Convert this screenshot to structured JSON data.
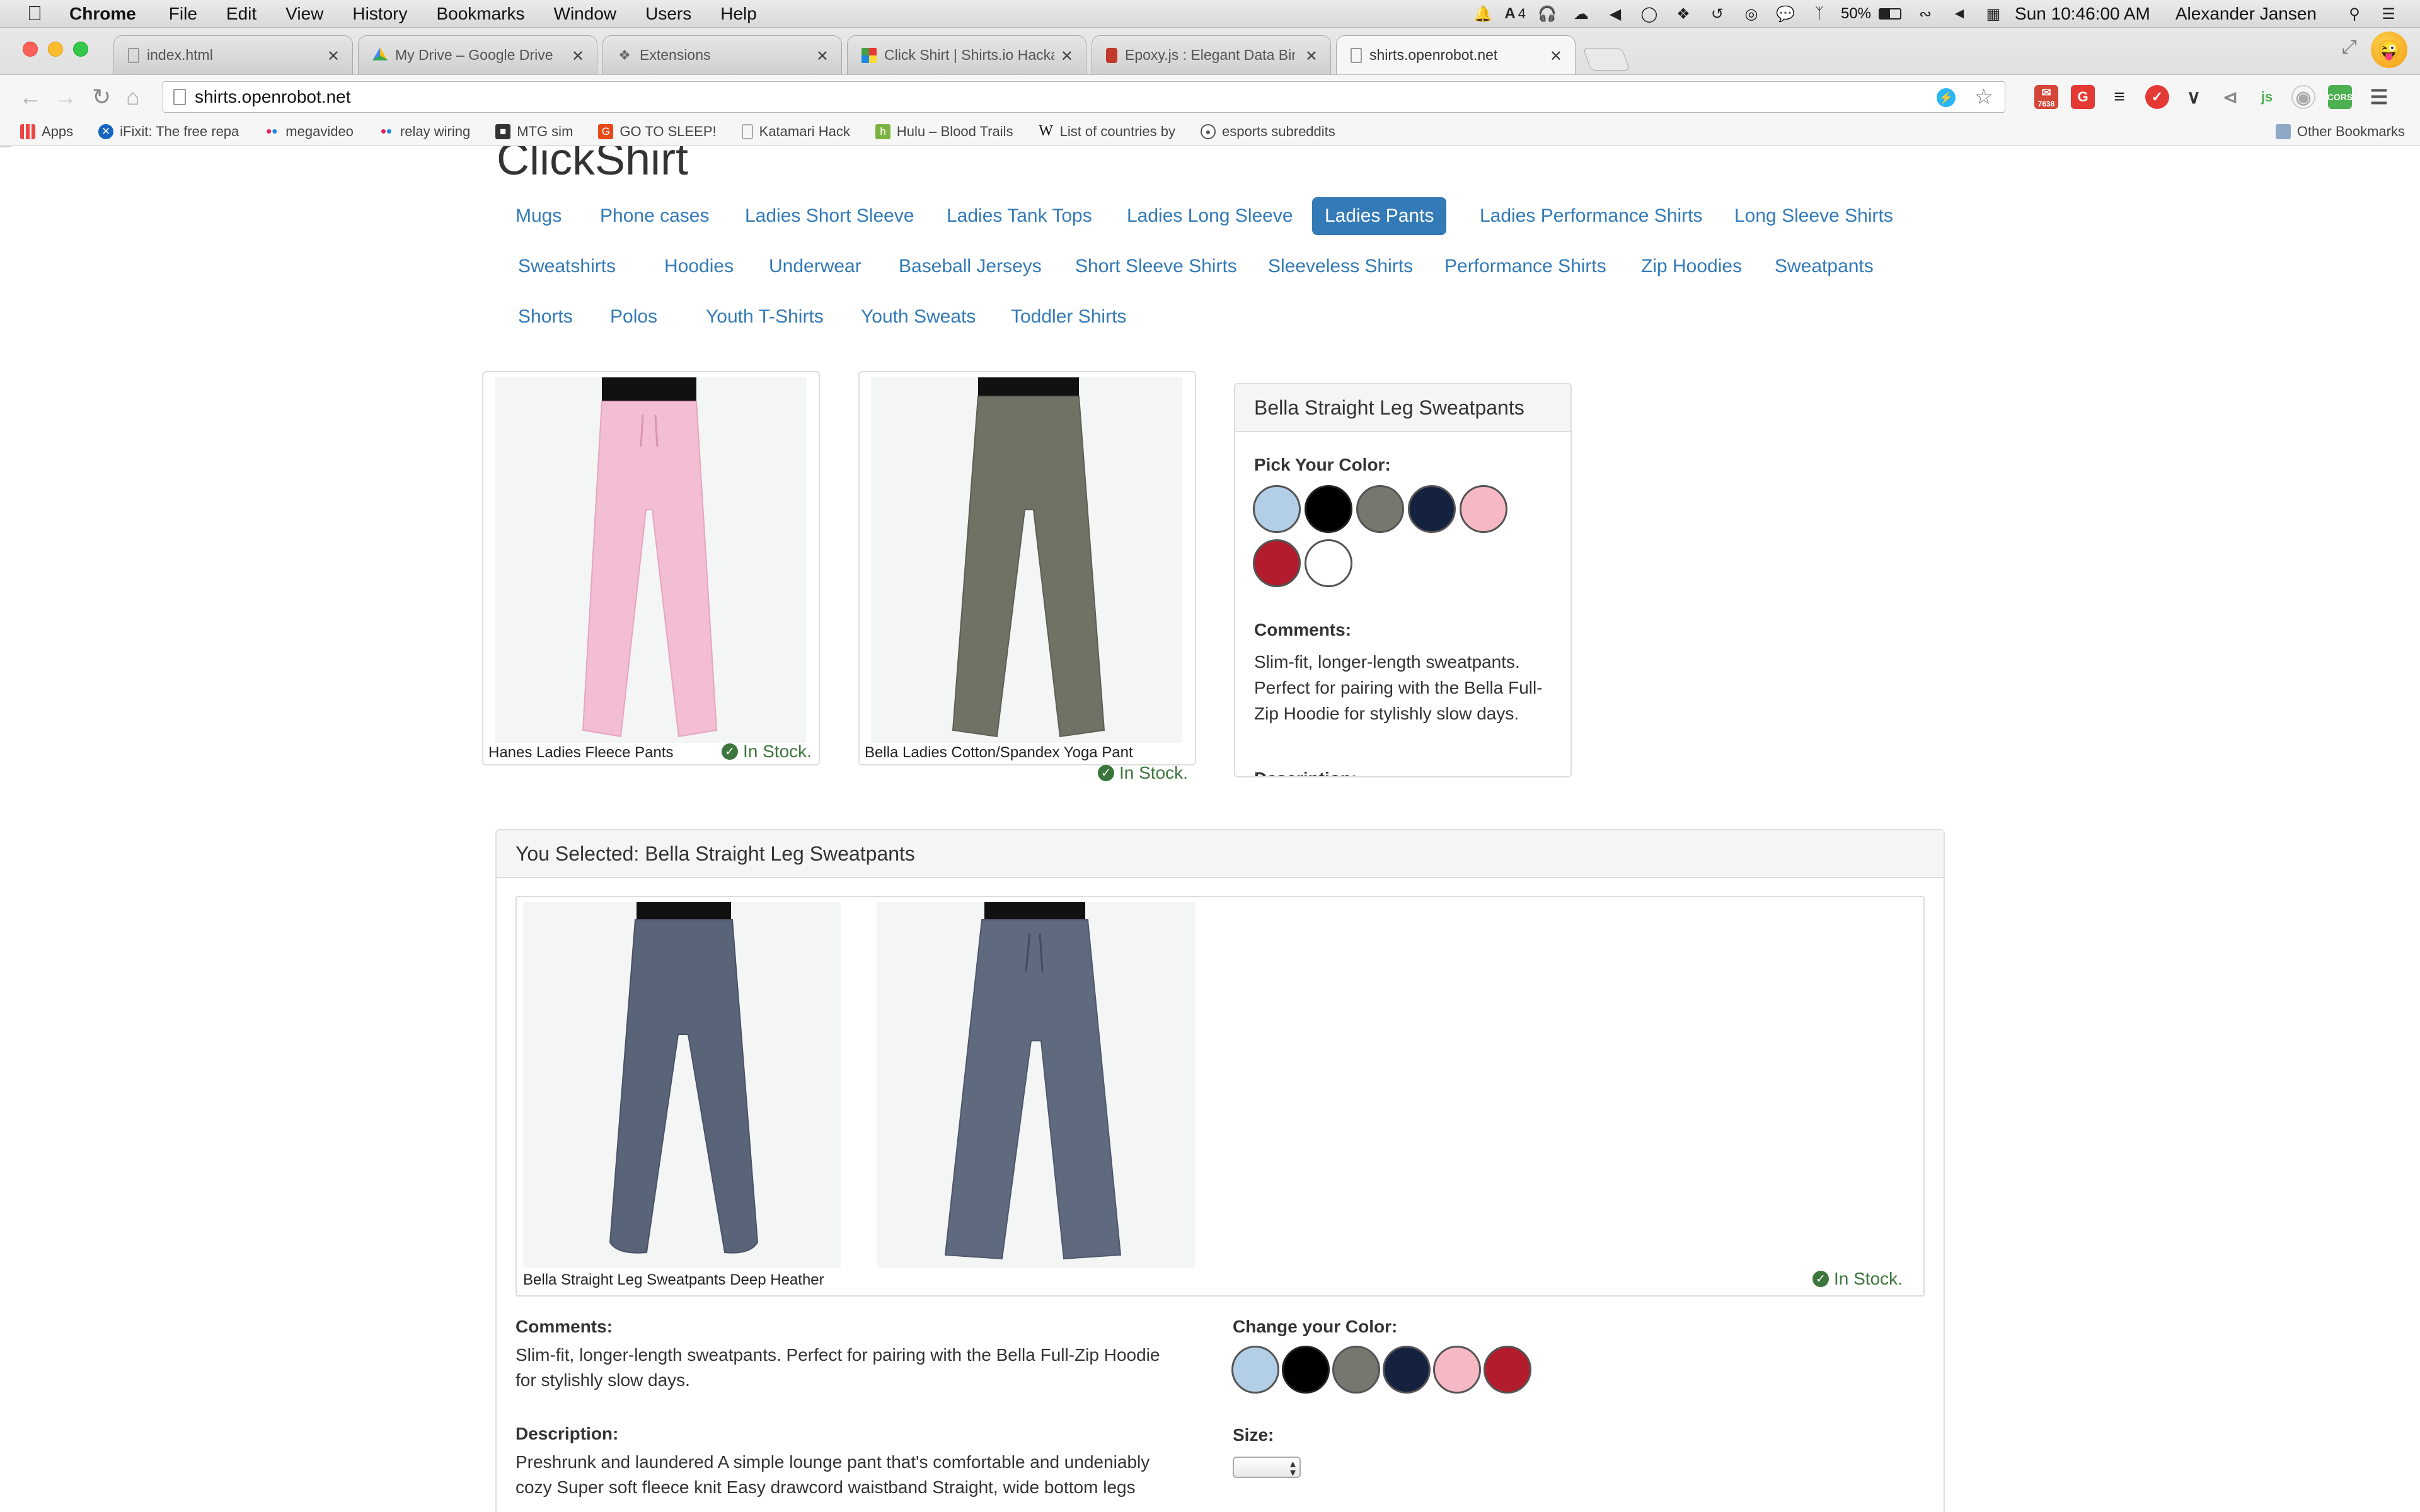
{
  "menubar": {
    "app": "Chrome",
    "items": [
      "File",
      "Edit",
      "View",
      "History",
      "Bookmarks",
      "Window",
      "Users",
      "Help"
    ],
    "adobe_count": "4",
    "battery": "50%",
    "clock": "Sun 10:46:00 AM",
    "user": "Alexander Jansen"
  },
  "tabs": [
    {
      "title": "index.html",
      "icon": "page-icon"
    },
    {
      "title": "My Drive – Google Drive",
      "icon": "google-drive-icon"
    },
    {
      "title": "Extensions",
      "icon": "puzzle-icon"
    },
    {
      "title": "Click Shirt | Shirts.io Hacka",
      "icon": "pinwheel-icon"
    },
    {
      "title": "Epoxy.js : Elegant Data Bin",
      "icon": "book-icon"
    },
    {
      "title": "shirts.openrobot.net",
      "icon": "page-icon"
    }
  ],
  "address": "shirts.openrobot.net",
  "gmail_count": "7638",
  "bookmarks": [
    {
      "label": "Apps",
      "icon": "apps-grid-icon"
    },
    {
      "label": "iFixit: The free repa",
      "icon": "ifixit-icon"
    },
    {
      "label": "megavideo",
      "icon": "flickr-dots-icon"
    },
    {
      "label": "relay wiring",
      "icon": "flickr-dots-icon"
    },
    {
      "label": "MTG sim",
      "icon": "mtg-icon"
    },
    {
      "label": "GO TO SLEEP!",
      "icon": "go-to-sleep-icon"
    },
    {
      "label": "Katamari Hack",
      "icon": "page-icon"
    },
    {
      "label": "Hulu – Blood Trails",
      "icon": "hulu-icon"
    },
    {
      "label": "List of countries by",
      "icon": "wikipedia-icon"
    },
    {
      "label": "esports subreddits",
      "icon": "reddit-icon"
    }
  ],
  "other_bookmarks": "Other Bookmarks",
  "page": {
    "brand": "ClickShirt",
    "categories_row1": [
      "Mugs",
      "Phone cases",
      "Ladies Short Sleeve",
      "Ladies Tank Tops",
      "Ladies Long Sleeve",
      "Ladies Pants",
      "Ladies Performance Shirts",
      "Long Sleeve Shirts"
    ],
    "categories_row2": [
      "Sweatshirts",
      "Hoodies",
      "Underwear",
      "Baseball Jerseys",
      "Short Sleeve Shirts",
      "Sleeveless Shirts",
      "Performance Shirts",
      "Zip Hoodies",
      "Sweatpants"
    ],
    "categories_row3": [
      "Shorts",
      "Polos",
      "Youth T-Shirts",
      "Youth Sweats",
      "Toddler Shirts"
    ],
    "active_category": "Ladies Pants",
    "products": [
      {
        "name": "Hanes Ladies Fleece Pants",
        "stock": "In Stock."
      },
      {
        "name": "Bella Ladies Cotton/Spandex Yoga Pant",
        "stock": "In Stock."
      }
    ],
    "detail": {
      "title": "Bella Straight Leg Sweatpants",
      "pick_color_label": "Pick Your Color:",
      "comments_label": "Comments:",
      "comments": "Slim-fit, longer-length sweatpants. Perfect for pairing with the Bella Full-Zip Hoodie for stylishly slow days.",
      "description_partial": "Description:"
    },
    "colors": [
      "#b3cfe8",
      "#000000",
      "#767870",
      "#14213f",
      "#f7b8c6",
      "#b21c2c",
      "#ffffff"
    ],
    "selected": {
      "heading": "You Selected: Bella Straight Leg Sweatpants",
      "caption": "Bella Straight Leg Sweatpants Deep Heather",
      "stock": "In Stock.",
      "comments_label": "Comments:",
      "comments_line1": "Slim-fit, longer-length sweatpants. Perfect for pairing with the Bella Full-Zip Hoodie",
      "comments_line2": "for stylishly slow days.",
      "description_label": "Description:",
      "description_line1": "Preshrunk and laundered A simple lounge pant that's comfortable and undeniably",
      "description_line2": "cozy Super soft fleece knit Easy drawcord waistband Straight, wide bottom legs",
      "change_color_label": "Change your Color:",
      "size_label": "Size:"
    }
  }
}
